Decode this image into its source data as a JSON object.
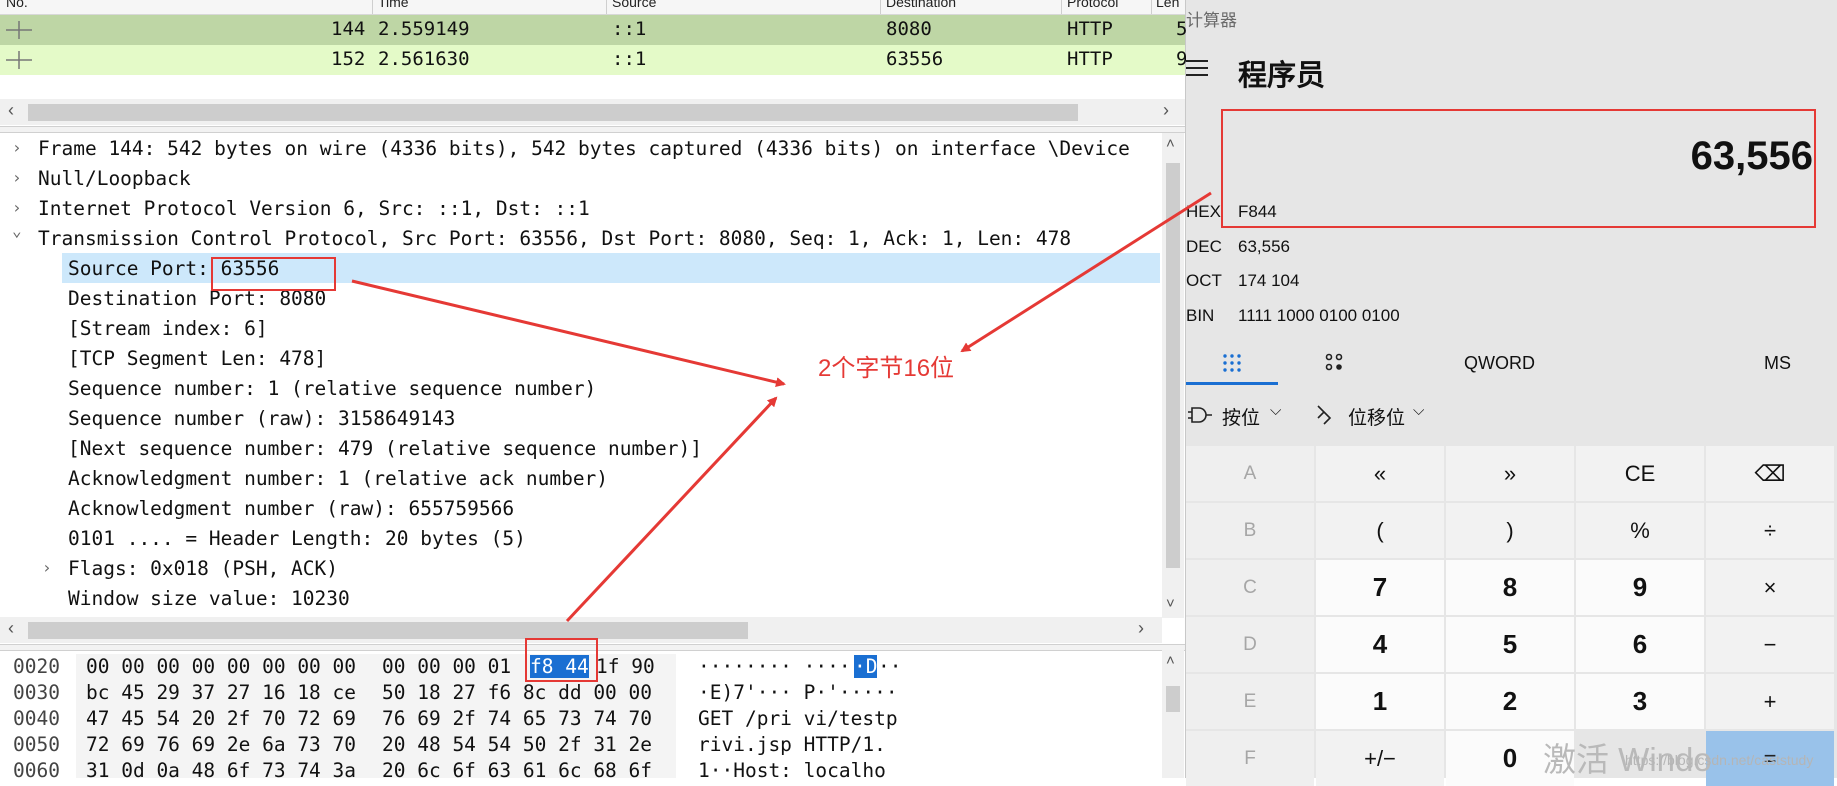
{
  "packet_list": {
    "columns": [
      "No.",
      "Time",
      "Source",
      "Destination",
      "Protocol",
      "Len"
    ],
    "rows": [
      {
        "no": "144",
        "time": "2.559149",
        "source": "::1",
        "destination": "8080",
        "protocol": "HTTP",
        "len": "5"
      },
      {
        "no": "152",
        "time": "2.561630",
        "source": "::1",
        "destination": "63556",
        "protocol": "HTTP",
        "len": "9"
      }
    ],
    "colors": {
      "row_selected": "#bed6a5",
      "row_other": "#e4fac8"
    }
  },
  "details": {
    "lines": [
      {
        "toggle": ">",
        "text": "Frame 144: 542 bytes on wire (4336 bits), 542 bytes captured (4336 bits) on interface \\Device"
      },
      {
        "toggle": ">",
        "text": "Null/Loopback"
      },
      {
        "toggle": ">",
        "text": "Internet Protocol Version 6, Src: ::1, Dst: ::1"
      },
      {
        "toggle": "v",
        "text": "Transmission Control Protocol, Src Port: 63556, Dst Port: 8080, Seq: 1, Ack: 1, Len: 478"
      },
      {
        "toggle": "",
        "text": "Source Port: 63556"
      },
      {
        "toggle": "",
        "text": "Destination Port: 8080"
      },
      {
        "toggle": "",
        "text": "[Stream index: 6]"
      },
      {
        "toggle": "",
        "text": "[TCP Segment Len: 478]"
      },
      {
        "toggle": "",
        "text": "Sequence number: 1    (relative sequence number)"
      },
      {
        "toggle": "",
        "text": "Sequence number (raw): 3158649143"
      },
      {
        "toggle": "",
        "text": "[Next sequence number: 479    (relative sequence number)]"
      },
      {
        "toggle": "",
        "text": "Acknowledgment number: 1    (relative ack number)"
      },
      {
        "toggle": "",
        "text": "Acknowledgment number (raw): 655759566"
      },
      {
        "toggle": "",
        "text": "0101 .... = Header Length: 20 bytes (5)"
      },
      {
        "toggle": ">",
        "text": "Flags: 0x018 (PSH, ACK)"
      },
      {
        "toggle": "",
        "text": "Window size value: 10230"
      }
    ]
  },
  "hex": {
    "rows": [
      {
        "offset": "0020",
        "b1": "00 00 00 00 00 00 00 00",
        "b2a": "00 00 00 01",
        "b2sel": "f8 44",
        "b2b": "1f 90",
        "ascii_a": "········ ····",
        "ascii_sel": "·D",
        "ascii_b": "··"
      },
      {
        "offset": "0030",
        "b1": "bc 45 29 37 27 16 18 ce",
        "b2a": "50 18 27 f6 8c dd 00 00",
        "b2sel": "",
        "b2b": "",
        "ascii_a": "·E)7'··· P·'·····",
        "ascii_sel": "",
        "ascii_b": ""
      },
      {
        "offset": "0040",
        "b1": "47 45 54 20 2f 70 72 69",
        "b2a": "76 69 2f 74 65 73 74 70",
        "b2sel": "",
        "b2b": "",
        "ascii_a": "GET /pri vi/testp",
        "ascii_sel": "",
        "ascii_b": ""
      },
      {
        "offset": "0050",
        "b1": "72 69 76 69 2e 6a 73 70",
        "b2a": "20 48 54 54 50 2f 31 2e",
        "b2sel": "",
        "b2b": "",
        "ascii_a": "rivi.jsp  HTTP/1.",
        "ascii_sel": "",
        "ascii_b": ""
      },
      {
        "offset": "0060",
        "b1": "31 0d 0a 48 6f 73 74 3a",
        "b2a": "20 6c 6f 63 61 6c 68 6f",
        "b2sel": "",
        "b2b": "",
        "ascii_a": "1··Host:  localho",
        "ascii_sel": "",
        "ascii_b": ""
      }
    ]
  },
  "calculator": {
    "title": "计算器",
    "mode": "程序员",
    "display": "63,556",
    "radix": [
      {
        "name": "HEX",
        "value": "F844"
      },
      {
        "name": "DEC",
        "value": "63,556"
      },
      {
        "name": "OCT",
        "value": "174 104"
      },
      {
        "name": "BIN",
        "value": "1111 1000 0100 0100"
      }
    ],
    "tabs": {
      "word": "QWORD",
      "memory": "MS"
    },
    "bitwise_label": "按位",
    "bitshift_label": "位移位",
    "keys": [
      [
        "A",
        "«",
        "»",
        "CE",
        "⌫"
      ],
      [
        "B",
        "(",
        ")",
        "%",
        "÷"
      ],
      [
        "C",
        "7",
        "8",
        "9",
        "×"
      ],
      [
        "D",
        "4",
        "5",
        "6",
        "−"
      ],
      [
        "E",
        "1",
        "2",
        "3",
        "+"
      ],
      [
        "F",
        "+/−",
        "0",
        "",
        "="
      ]
    ]
  },
  "annotation": {
    "label": "2个字节16位",
    "color": "#e53935"
  },
  "watermark": {
    "text": "激活 Windo",
    "url": "https://blog.csdn.net/caststudy"
  }
}
